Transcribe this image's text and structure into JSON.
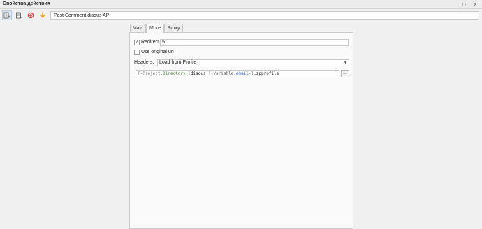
{
  "window": {
    "title": "Свойства действия",
    "pin_icon": "pin-icon",
    "close_icon": "close-icon"
  },
  "toolbar": {
    "action_name": "Post Comment disqus API",
    "icons": [
      "properties-list-icon",
      "log-document-icon",
      "record-stop-icon",
      "arrow-down-icon"
    ],
    "colors": {
      "stop": "#e04040",
      "arrow": "#f0a020"
    }
  },
  "tabs": [
    {
      "label": "Main",
      "active": false
    },
    {
      "label": "More",
      "active": true
    },
    {
      "label": "Proxy",
      "active": false
    }
  ],
  "more": {
    "redirect": {
      "label": "Redirect",
      "checked": true,
      "value": "5"
    },
    "original_url": {
      "label": "Use original url",
      "checked": false
    },
    "headers": {
      "label": "Headers:",
      "selected": "Load from Profile"
    },
    "profile_path": {
      "parts": [
        {
          "text": "{-Project.",
          "kind": "brace"
        },
        {
          "text": "Directory",
          "kind": "a"
        },
        {
          "text": "-}",
          "kind": "brace"
        },
        {
          "text": "disqus ",
          "kind": "plain"
        },
        {
          "text": "{-Variable.",
          "kind": "brace"
        },
        {
          "text": "email",
          "kind": "b"
        },
        {
          "text": "-}",
          "kind": "brace"
        },
        {
          "text": ".zpprofile",
          "kind": "plain"
        }
      ],
      "browse_label": "..."
    }
  }
}
